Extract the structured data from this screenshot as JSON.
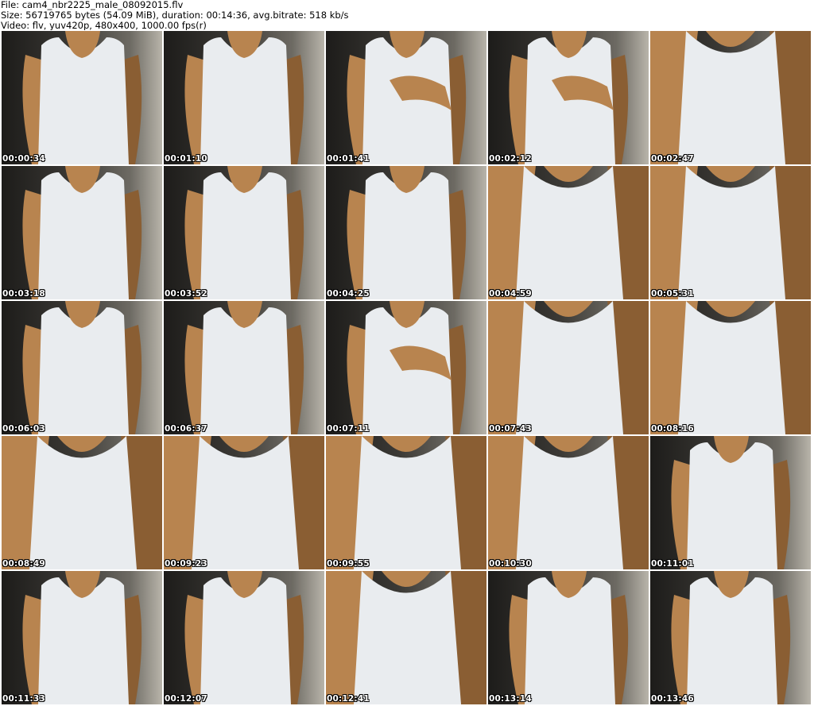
{
  "header": {
    "file_line": "File: cam4_nbr2225_male_08092015.flv",
    "size_line": "Size: 56719765 bytes (54.09 MiB), duration: 00:14:36, avg.bitrate: 518 kb/s",
    "video_line": "Video: flv, yuv420p, 480x400, 1000.00 fps(r)"
  },
  "thumbnails": [
    {
      "timestamp": "00:00:34",
      "pose": "wide"
    },
    {
      "timestamp": "00:01:10",
      "pose": "wide"
    },
    {
      "timestamp": "00:01:41",
      "pose": "hand-chest"
    },
    {
      "timestamp": "00:02:12",
      "pose": "hand-chest"
    },
    {
      "timestamp": "00:02:47",
      "pose": "close"
    },
    {
      "timestamp": "00:03:18",
      "pose": "wide"
    },
    {
      "timestamp": "00:03:52",
      "pose": "wide"
    },
    {
      "timestamp": "00:04:25",
      "pose": "wide"
    },
    {
      "timestamp": "00:04:59",
      "pose": "close"
    },
    {
      "timestamp": "00:05:31",
      "pose": "close"
    },
    {
      "timestamp": "00:06:03",
      "pose": "wide"
    },
    {
      "timestamp": "00:06:37",
      "pose": "wide"
    },
    {
      "timestamp": "00:07:11",
      "pose": "hand-chest"
    },
    {
      "timestamp": "00:07:43",
      "pose": "close"
    },
    {
      "timestamp": "00:08:16",
      "pose": "close"
    },
    {
      "timestamp": "00:08:49",
      "pose": "close"
    },
    {
      "timestamp": "00:09:23",
      "pose": "close"
    },
    {
      "timestamp": "00:09:55",
      "pose": "close"
    },
    {
      "timestamp": "00:10:30",
      "pose": "close"
    },
    {
      "timestamp": "00:11:01",
      "pose": "wide"
    },
    {
      "timestamp": "00:11:33",
      "pose": "wide"
    },
    {
      "timestamp": "00:12:07",
      "pose": "wide"
    },
    {
      "timestamp": "00:12:41",
      "pose": "close"
    },
    {
      "timestamp": "00:13:14",
      "pose": "wide"
    },
    {
      "timestamp": "00:13:46",
      "pose": "wide"
    }
  ],
  "colors": {
    "shirt": "#e9ecef",
    "skin": "#b8844f",
    "skin_shadow": "#8a5e33",
    "timestamp_text": "#ffffff"
  }
}
